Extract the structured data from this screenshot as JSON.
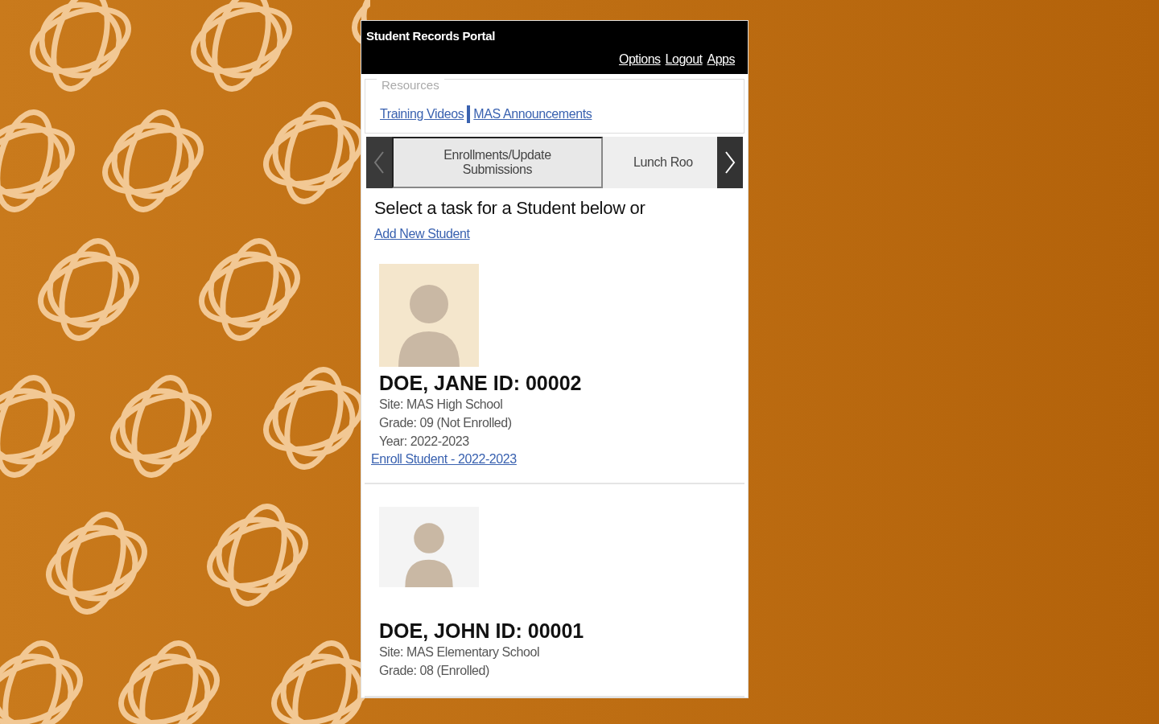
{
  "header": {
    "title": "Student Records Portal",
    "links": [
      "Options",
      "Logout",
      "Apps"
    ]
  },
  "resources": {
    "legend": "Resources",
    "links": [
      "Training Videos",
      "MAS Announcements"
    ]
  },
  "tabs": [
    {
      "label": "Enrollments/Update Submissions",
      "selected": true
    },
    {
      "label": "Lunch Roo",
      "selected": false
    }
  ],
  "prompt": "Select a task for a Student below or",
  "add_link": "Add New Student",
  "students": [
    {
      "name": "DOE, JANE ID: 00002",
      "details": [
        "Site: MAS High School",
        "Grade: 09 (Not Enrolled)",
        "Year: 2022-2023"
      ],
      "action": "Enroll Student - 2022-2023"
    },
    {
      "name": "DOE, JOHN ID: 00001",
      "details": [
        "Site: MAS Elementary School",
        "Grade: 08 (Enrolled)"
      ]
    }
  ]
}
